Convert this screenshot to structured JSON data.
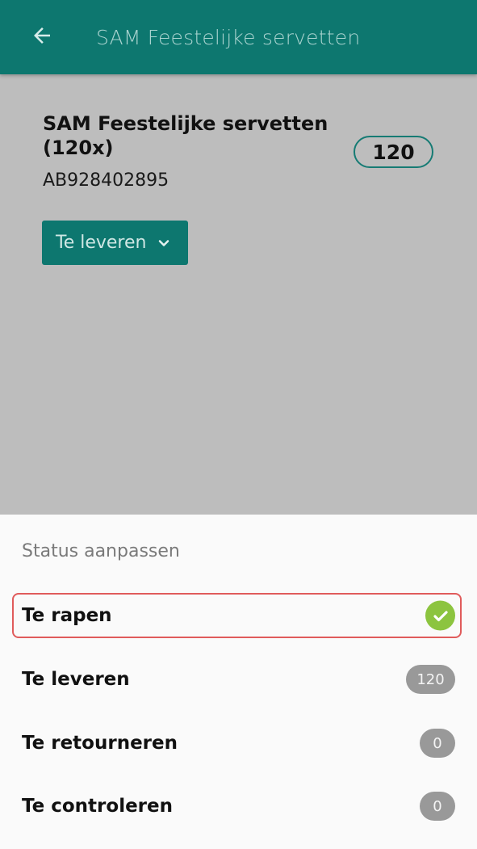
{
  "appbar": {
    "back_icon": "arrow-left-icon",
    "title": "SAM Feestelijke servetten"
  },
  "product": {
    "name": "SAM Feestelijke servetten (120x)",
    "code": "AB928402895",
    "quantity": "120",
    "status_button_label": "Te leveren",
    "status_button_icon": "chevron-down-icon"
  },
  "sheet": {
    "title": "Status aanpassen",
    "options": [
      {
        "label": "Te rapen",
        "selected": true,
        "indicator_icon": "check-circle-icon"
      },
      {
        "label": "Te leveren",
        "count": "120"
      },
      {
        "label": "Te retourneren",
        "count": "0"
      },
      {
        "label": "Te controleren",
        "count": "0"
      }
    ]
  },
  "colors": {
    "primary": "#0d776f",
    "selection_border": "#e05b5b",
    "check_green": "#8cc43f",
    "badge_gray": "#999999"
  }
}
